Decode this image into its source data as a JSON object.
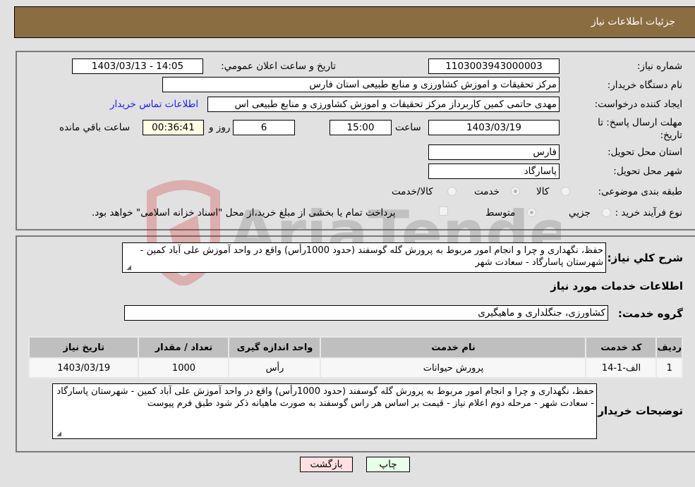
{
  "header": {
    "title": "جزئیات اطلاعات نیاز"
  },
  "fields": {
    "need_number": {
      "label": "شماره نیاز:",
      "value": "1103003943000003"
    },
    "announce_datetime": {
      "label": "تاریخ و ساعت اعلان عمومي:",
      "value": "1403/03/13 - 14:05"
    },
    "buyer_org": {
      "label": "نام دستگاه خریدار:",
      "value": "مرکز تحقیقات و اموزش کشاورزی و منابع طبیعی استان فارس"
    },
    "requester": {
      "label": "ایجاد کننده درخواست:",
      "value": "مهدی حاتمی کمین کاربرداز  مرکز تحقیقات و اموزش کشاورزی و منابع طبیعی اس"
    },
    "buyer_contact_link": "اطلاعات تماس خریدار",
    "deadline": {
      "label": "مهلت ارسال پاسخ: تا تاریخ:",
      "date": "1403/03/19",
      "time_label": "ساعت",
      "time": "15:00",
      "days": "6",
      "days_label": "روز و",
      "remaining": "00:36:41",
      "remaining_label": "ساعت باقي مانده"
    },
    "province": {
      "label": "استان محل تحویل:",
      "value": "فارس"
    },
    "city": {
      "label": "شهر محل تحویل:",
      "value": "پاسارگاد"
    },
    "category": {
      "label": "طبقه بندی موضوعی:",
      "options": [
        "کالا",
        "خدمت",
        "کالا/خدمت"
      ],
      "selected": "خدمت"
    },
    "purchase_type": {
      "label": "نوع فرآیند خرید :",
      "options": [
        "جزيي",
        "متوسط"
      ],
      "selected": "متوسط",
      "treasury_checkbox_label": "پرداخت تمام یا بخشی از مبلغ خرید،از محل \"اسناد خزانه اسلامی\" خواهد بود.",
      "treasury_checked": false
    }
  },
  "description": {
    "label": "شرح کلي نیاز:",
    "value": "حفظ، نگهداری و چرا و انجام امور مربوط به پرورش گله گوسفند (حدود 1000رأس) واقع در واحد آموزش علی آباد کمین - شهرستان پاسارگاد - سعادت شهر"
  },
  "services_section": {
    "title": "اطلاعات خدمات مورد نیاز",
    "service_group_label": "گروه خدمت:",
    "service_group_value": "کشاورزی، جنگلداری و ماهیگیری"
  },
  "table": {
    "headers": [
      "ردیف",
      "کد خدمت",
      "نام خدمت",
      "واحد اندازه گیری",
      "تعداد / مقدار",
      "تاریخ نیاز"
    ],
    "rows": [
      [
        "1",
        "الف-1-14",
        "پرورش حیوانات",
        "رأس",
        "1000",
        "1403/03/19"
      ]
    ]
  },
  "buyer_notes": {
    "label": "توضیحات خریدار:",
    "value": "حفظ، نگهداری و چرا و انجام امور مربوط به پرورش گله گوسفند (حدود 1000رأس) واقع در واحد آموزش علی آباد کمین - شهرستان پاسارگاد - سعادت شهر - مرحله دوم اعلام نیاز  - قیمت بر اساس هر راس گوسفند به صورت ماهیانه ذکر شود طبق فرم پیوست"
  },
  "buttons": {
    "back": "بازگشت",
    "print": "چاپ"
  },
  "watermark": {
    "text": "AriaTender.neT"
  },
  "colors": {
    "header_bg": "#8b6d42",
    "link": "#1a1aff",
    "back_btn": "#ffe0e0",
    "print_btn": "#e8ffe8",
    "remaining_bg": "#ffffe6"
  }
}
